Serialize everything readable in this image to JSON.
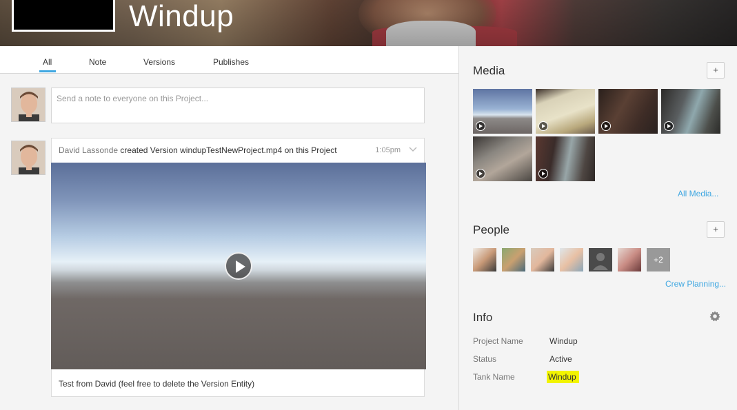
{
  "project": {
    "title": "Windup"
  },
  "tabs": [
    {
      "label": "All",
      "active": true
    },
    {
      "label": "Note",
      "active": false
    },
    {
      "label": "Versions",
      "active": false
    },
    {
      "label": "Publishes",
      "active": false
    }
  ],
  "composer": {
    "placeholder": "Send a note to everyone on this Project..."
  },
  "activity": {
    "user": "David Lassonde",
    "action": "created Version",
    "version_name": "windupTestNewProject.mp4",
    "target": "on this Project",
    "time": "1:05pm",
    "caption": "Test from David (feel free to delete the Version Entity)"
  },
  "media": {
    "title": "Media",
    "add_label": "+",
    "all_link": "All Media...",
    "thumbnails": [
      "sky-horizon",
      "balcony-render",
      "dark-room",
      "character-window",
      "room-interior",
      "character-scene"
    ]
  },
  "people": {
    "title": "People",
    "add_label": "+",
    "more_count": "+2",
    "link": "Crew Planning..."
  },
  "info": {
    "title": "Info",
    "fields": [
      {
        "label": "Project Name",
        "value": "Windup"
      },
      {
        "label": "Status",
        "value": "Active"
      },
      {
        "label": "Tank Name",
        "value": "Windup"
      }
    ]
  },
  "colors": {
    "accent": "#3fa7e1",
    "highlight": "#f2f400"
  }
}
